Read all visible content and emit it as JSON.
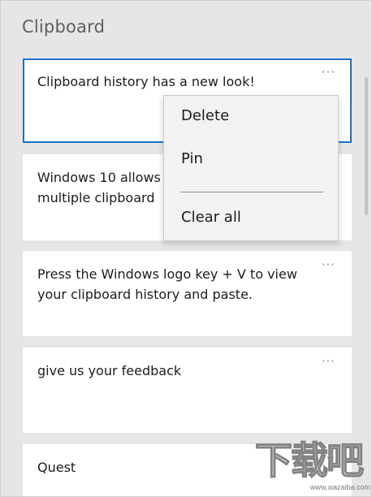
{
  "app": {
    "title": "Clipboard"
  },
  "items": [
    {
      "text": "Clipboard history has a new look!",
      "more": "···"
    },
    {
      "text": "Windows 10 allows you to store multiple clipboard items.",
      "visible_text": "Windows 10 allows\nmultiple clipboard",
      "more": "···"
    },
    {
      "text": "Press the Windows logo key + V to view your clipboard history and paste.",
      "more": "···"
    },
    {
      "text": "give us your feedback",
      "more": "···"
    },
    {
      "text": "Quest",
      "more": "···"
    }
  ],
  "context_menu": {
    "delete_label": "Delete",
    "pin_label": "Pin",
    "clear_all_label": "Clear all"
  },
  "watermark": {
    "chars": "下载吧",
    "url": "www.xiazaiba.com"
  },
  "colors": {
    "background": "#e6e6e6",
    "card": "#ffffff",
    "selected_border": "#1a72c7",
    "menu_background": "#f2f2f2"
  }
}
